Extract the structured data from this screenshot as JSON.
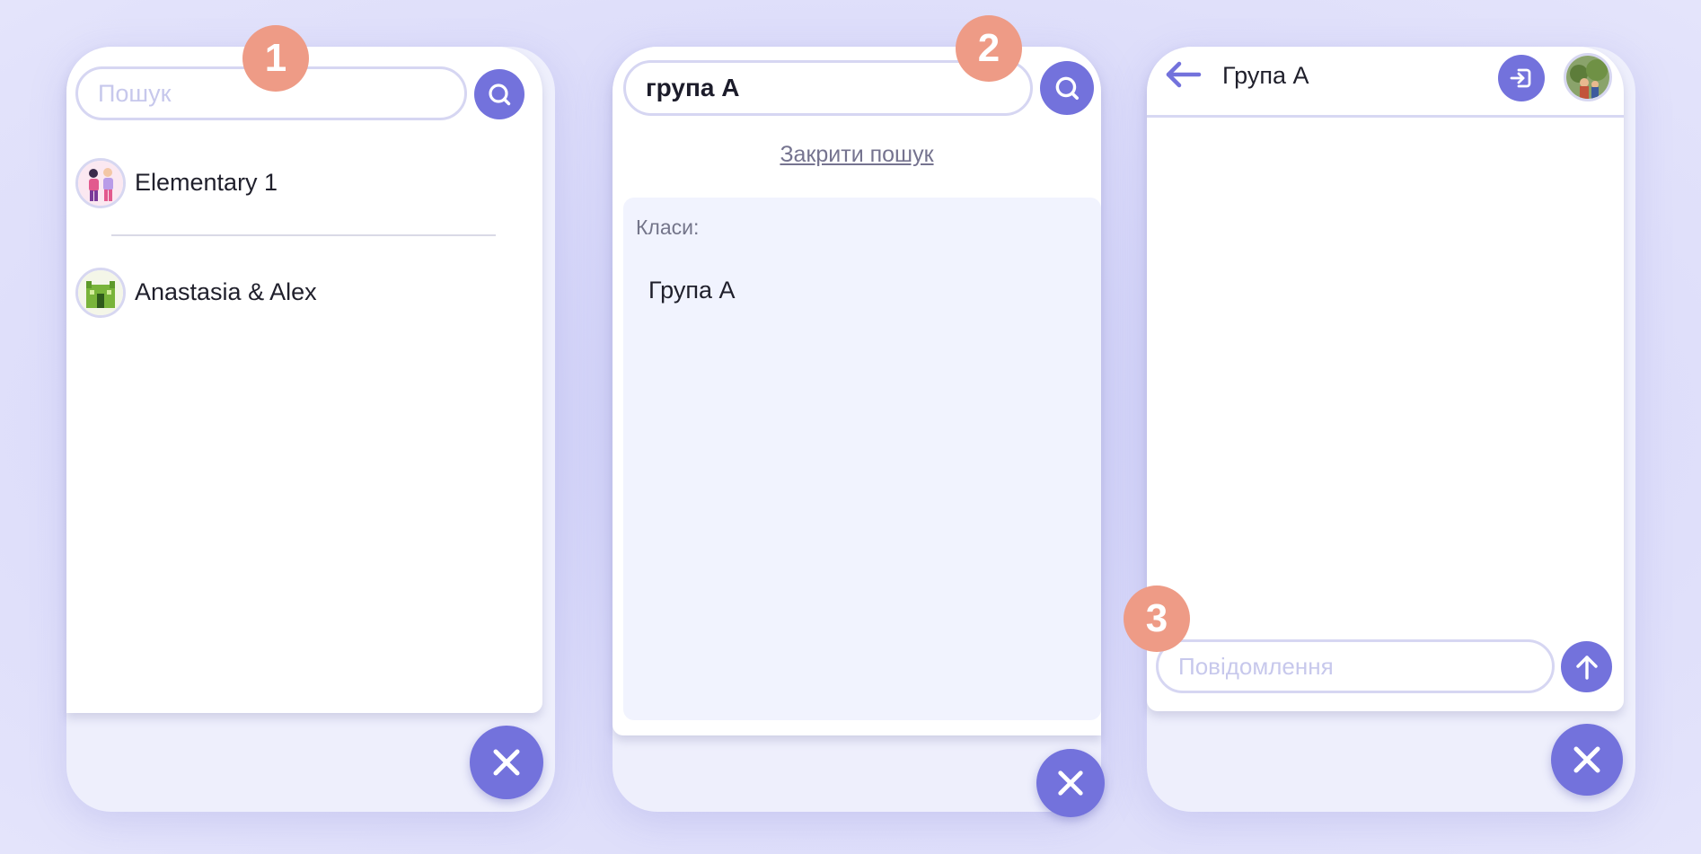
{
  "panel1": {
    "badge": "1",
    "search_placeholder": "Пошук",
    "chats": [
      {
        "name": "Elementary 1",
        "avatar_icon": "group-illustration-icon"
      },
      {
        "name": "Anastasia & Alex",
        "avatar_icon": "building-illustration-icon"
      }
    ],
    "search_icon": "search-icon",
    "close_icon": "close-icon"
  },
  "panel2": {
    "badge": "2",
    "search_value": "група А",
    "close_search_link": "Закрити пошук",
    "results_heading": "Класи:",
    "results": [
      "Група А"
    ],
    "search_icon": "search-icon",
    "close_icon": "close-icon"
  },
  "panel3": {
    "badge": "3",
    "title": "Група А",
    "message_placeholder": "Повідомлення",
    "back_icon": "arrow-left-icon",
    "exit_icon": "exit-icon",
    "send_icon": "arrow-up-icon",
    "close_icon": "close-icon"
  },
  "colors": {
    "accent": "#7372dc",
    "badge": "#ee9b86",
    "panel_bg": "#eeeffc",
    "results_bg": "#f1f3fe"
  }
}
